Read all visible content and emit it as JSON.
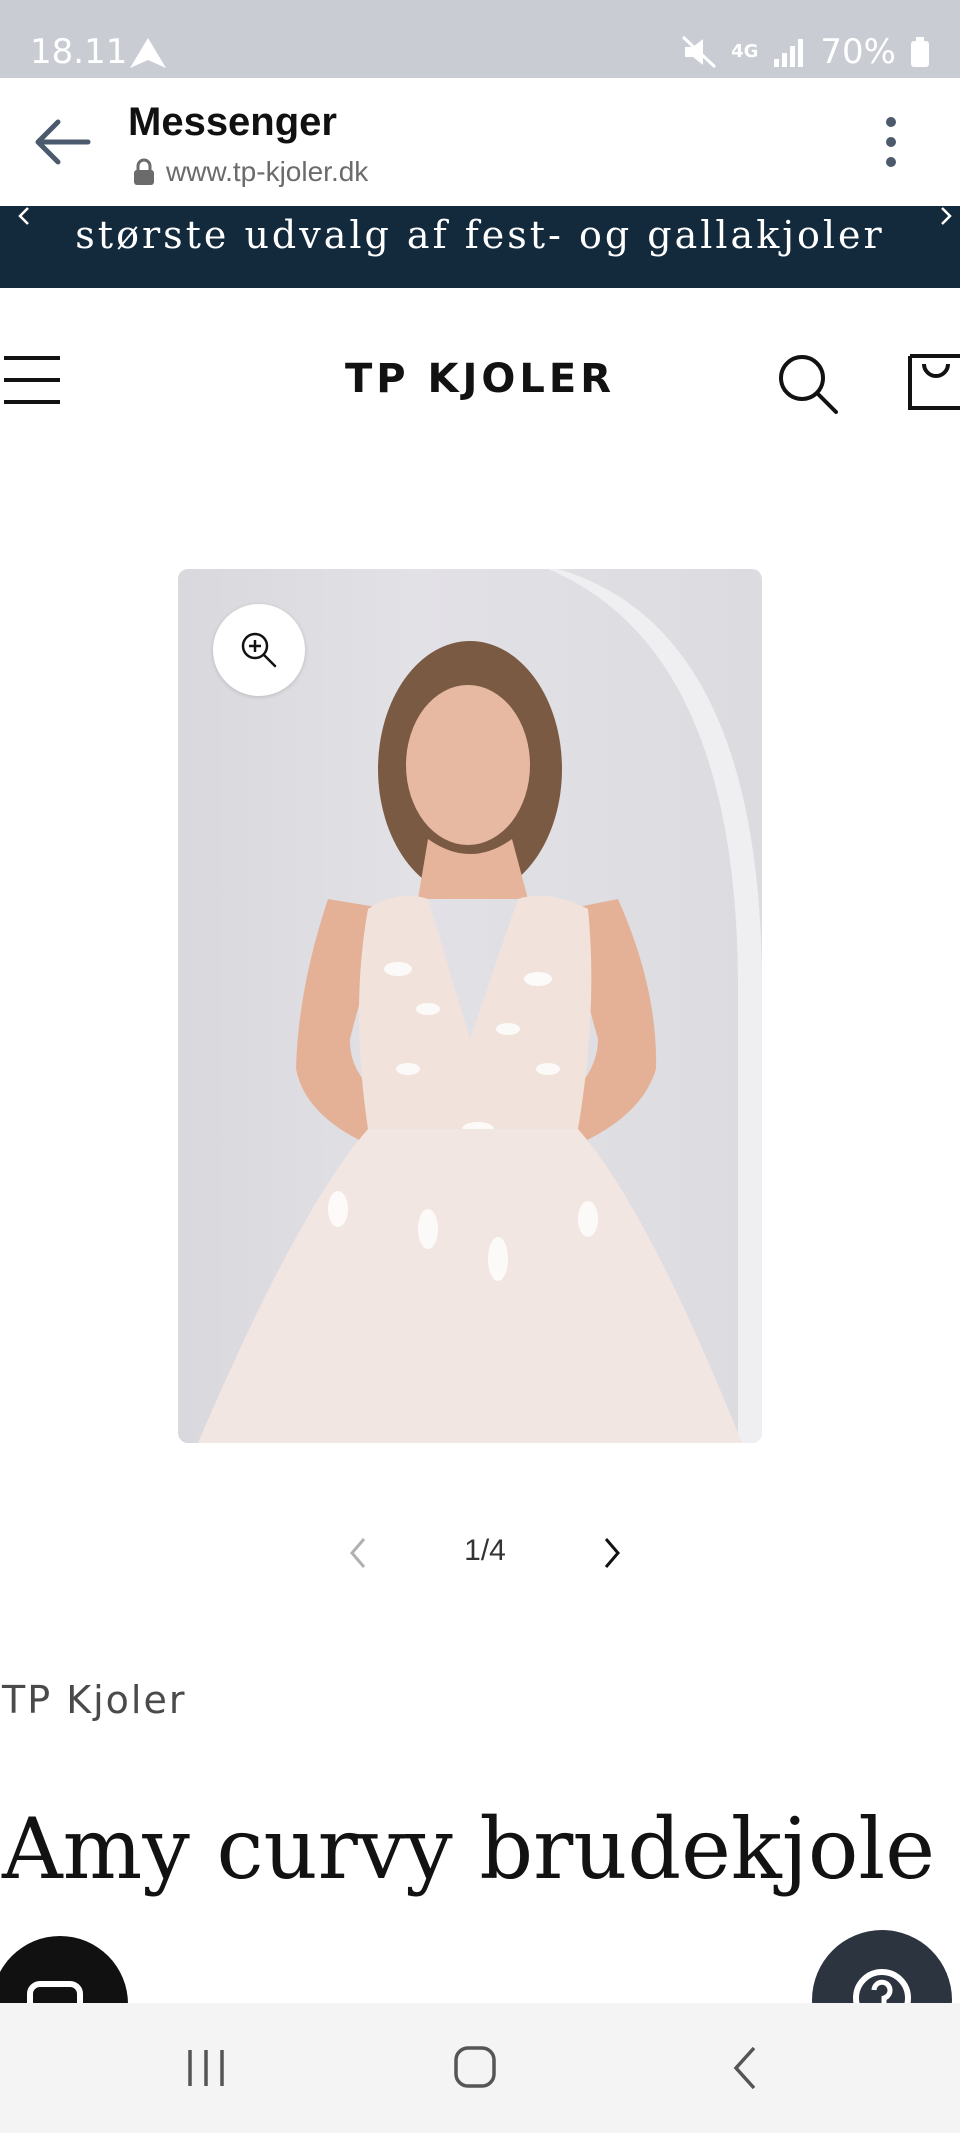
{
  "status_bar": {
    "time": "18.11",
    "network": "4G",
    "battery": "70%"
  },
  "app_bar": {
    "title": "Messenger",
    "url": "www.tp-kjoler.dk"
  },
  "announcement": {
    "text": "største udvalg af fest- og gallakjoler"
  },
  "store_header": {
    "brand": "TP KJOLER"
  },
  "product": {
    "image_counter": "1/4",
    "vendor": "TP Kjoler",
    "title": "Amy curvy brudekjole"
  },
  "colors": {
    "announcement_bg": "#132a3d",
    "status_bar_bg": "#c9ccd3",
    "help_button_bg": "#2c3440"
  }
}
